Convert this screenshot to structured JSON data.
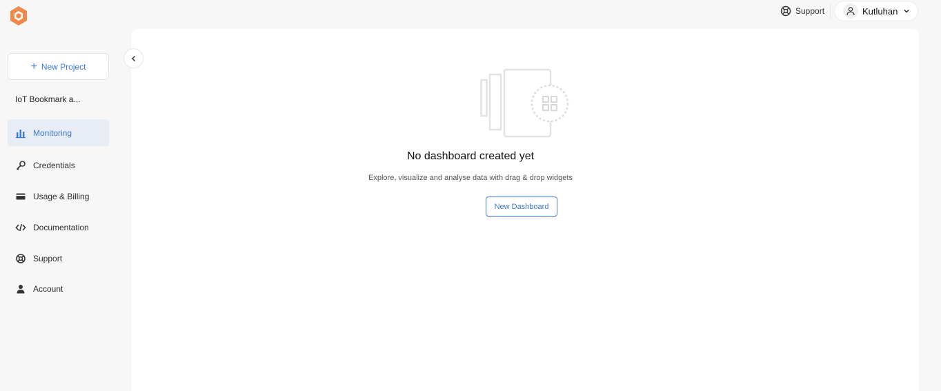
{
  "brand": {
    "accent": "#f08a4b",
    "link": "#3c78d8"
  },
  "header": {
    "support_label": "Support",
    "user_name": "Kutluhan"
  },
  "sidebar": {
    "new_project_label": "New Project",
    "project_name": "IoT Bookmark a...",
    "items": [
      {
        "label": "Monitoring",
        "icon": "bar-chart-icon",
        "active": true
      },
      {
        "label": "Credentials",
        "icon": "key-icon"
      },
      {
        "label": "Usage & Billing",
        "icon": "credit-card-icon"
      },
      {
        "label": "Documentation",
        "icon": "code-icon"
      },
      {
        "label": "Support",
        "icon": "lifebuoy-icon"
      },
      {
        "label": "Account",
        "icon": "user-icon"
      }
    ]
  },
  "main": {
    "empty_title": "No dashboard created yet",
    "empty_subtitle": "Explore, visualize and analyse data with drag & drop widgets",
    "new_dashboard_label": "New Dashboard"
  }
}
